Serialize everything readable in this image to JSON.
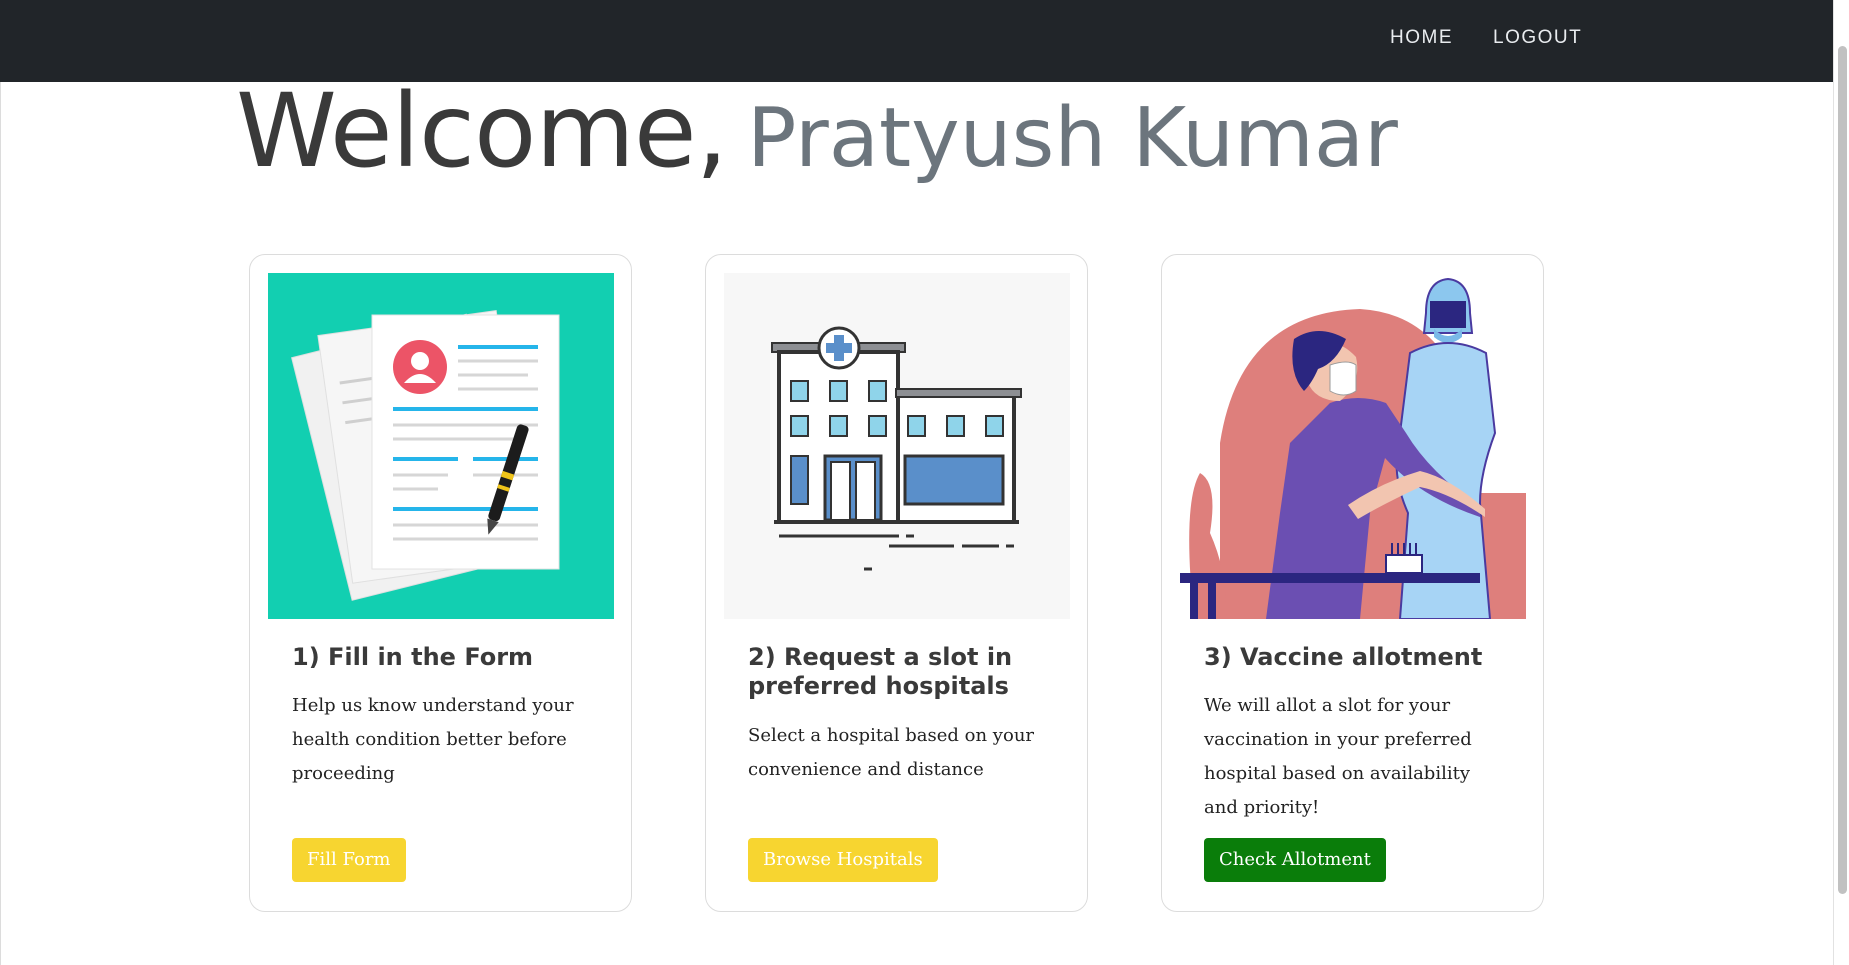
{
  "nav": {
    "home_label": "HOME",
    "logout_label": "LOGOUT"
  },
  "welcome": {
    "greeting": "Welcome,",
    "user_name": "Pratyush Kumar"
  },
  "cards": [
    {
      "title": "1) Fill in the Form",
      "text": "Help us know understand your health condition better before proceeding",
      "button_label": "Fill Form",
      "image_icon": "documents-illustration",
      "accent_color": "#12cfb1",
      "button_color": "#f7d530"
    },
    {
      "title": "2) Request a slot in preferred hospitals",
      "text": "Select a hospital based on your convenience and distance",
      "button_label": "Browse Hospitals",
      "image_icon": "hospital-illustration",
      "button_color": "#f7d530"
    },
    {
      "title": "3) Vaccine allotment",
      "text": "We will allot a slot for your vaccination in your preferred hospital based on availability and priority!",
      "button_label": "Check Allotment",
      "image_icon": "vaccination-illustration",
      "button_color": "#0a7d0a"
    }
  ],
  "colors": {
    "navbar_bg": "#212529",
    "name_color": "#6c757d"
  }
}
